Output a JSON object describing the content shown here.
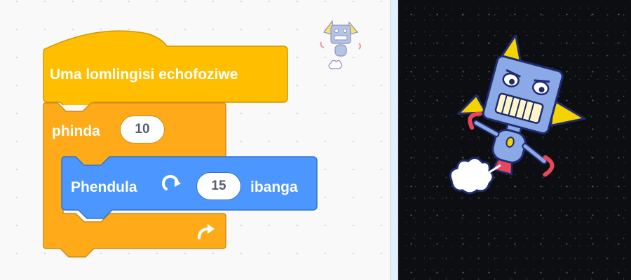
{
  "hat_block": {
    "label": "Uma lomlingisi echofoziwe"
  },
  "repeat_block": {
    "label": "phinda",
    "count": "10",
    "loop_icon": "loop-arrow-icon"
  },
  "turn_block": {
    "label": "Phendula",
    "degrees": "15",
    "unit": "ibanga",
    "rotate_icon": "rotate-clockwise-icon"
  },
  "stage": {
    "sprite": "robot-sprite",
    "backdrop": "stars-backdrop"
  },
  "colors": {
    "events": "#ffbf00",
    "control": "#ffab19",
    "motion": "#4c97ff",
    "stage_bg": "#0d0e12"
  }
}
